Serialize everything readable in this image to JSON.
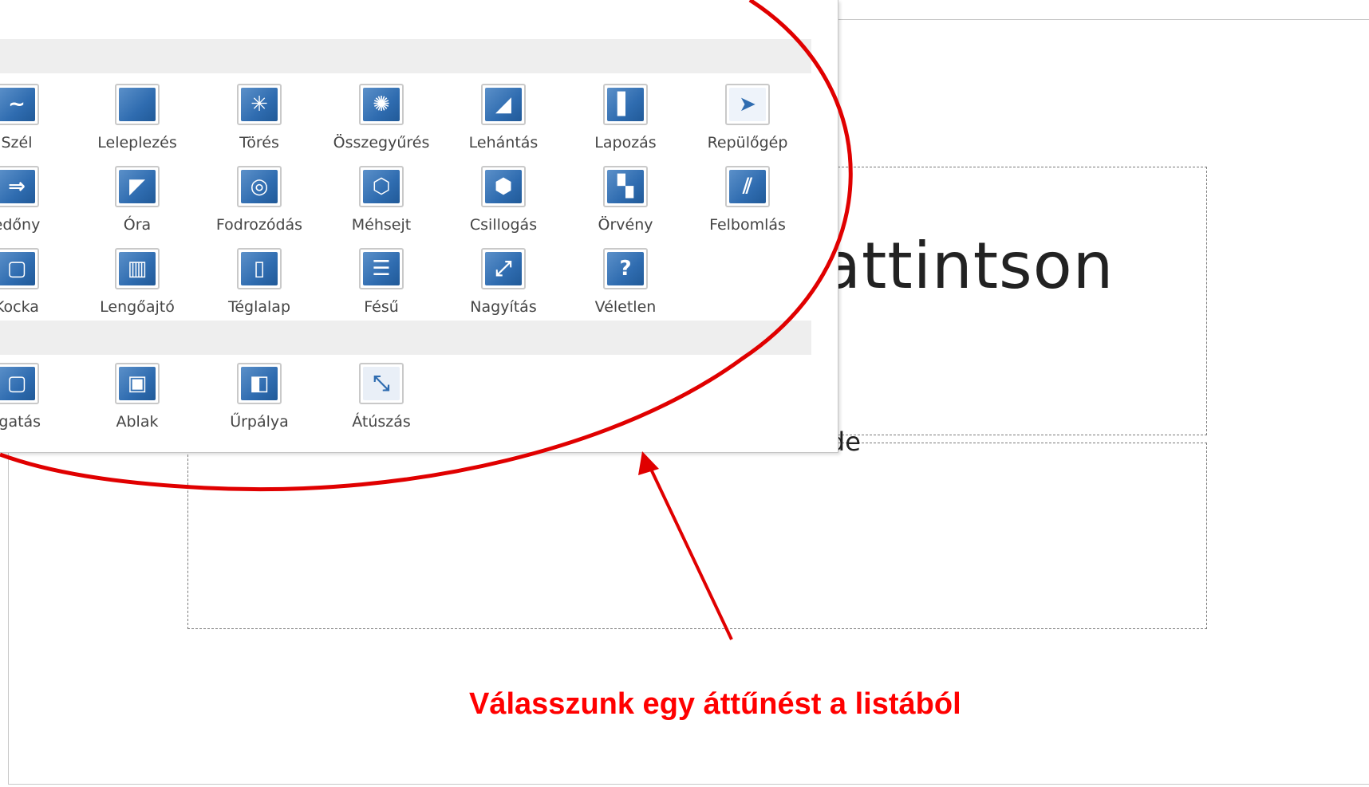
{
  "slide": {
    "title_placeholder": "attintson",
    "subtitle_placeholder": "ide"
  },
  "gallery": {
    "rows": [
      [
        {
          "label": "Szél",
          "icon": "wind-icon"
        },
        {
          "label": "Leleplezés",
          "icon": "reveal-icon"
        },
        {
          "label": "Törés",
          "icon": "shatter-icon"
        },
        {
          "label": "Összegyűrés",
          "icon": "crumple-icon"
        },
        {
          "label": "Lehántás",
          "icon": "peel-off-icon"
        },
        {
          "label": "Lapozás",
          "icon": "page-curl-icon"
        },
        {
          "label": "Repülőgép",
          "icon": "airplane-icon"
        }
      ],
      [
        {
          "label": "edőny",
          "icon": "blinds-icon"
        },
        {
          "label": "Óra",
          "icon": "clock-icon"
        },
        {
          "label": "Fodrozódás",
          "icon": "ripple-icon"
        },
        {
          "label": "Méhsejt",
          "icon": "honeycomb-icon"
        },
        {
          "label": "Csillogás",
          "icon": "glitter-icon"
        },
        {
          "label": "Örvény",
          "icon": "vortex-icon"
        },
        {
          "label": "Felbomlás",
          "icon": "shred-icon"
        }
      ],
      [
        {
          "label": "Kocka",
          "icon": "cube-icon"
        },
        {
          "label": "Lengőajtó",
          "icon": "doors-icon"
        },
        {
          "label": "Téglalap",
          "icon": "box-icon"
        },
        {
          "label": "Fésű",
          "icon": "comb-icon"
        },
        {
          "label": "Nagyítás",
          "icon": "zoom-icon"
        },
        {
          "label": "Véletlen",
          "icon": "random-icon"
        }
      ],
      [
        {
          "label": "rgatás",
          "icon": "rotate-icon"
        },
        {
          "label": "Ablak",
          "icon": "window-icon"
        },
        {
          "label": "Űrpálya",
          "icon": "orbit-icon"
        },
        {
          "label": "Átúszás",
          "icon": "fly-through-icon"
        }
      ]
    ]
  },
  "annotation": {
    "caption": "Válasszunk egy áttűnést a listából",
    "color": "#ff0000"
  },
  "colors": {
    "icon_blue": "#2f6cb0",
    "section_header": "#eeeeee"
  }
}
